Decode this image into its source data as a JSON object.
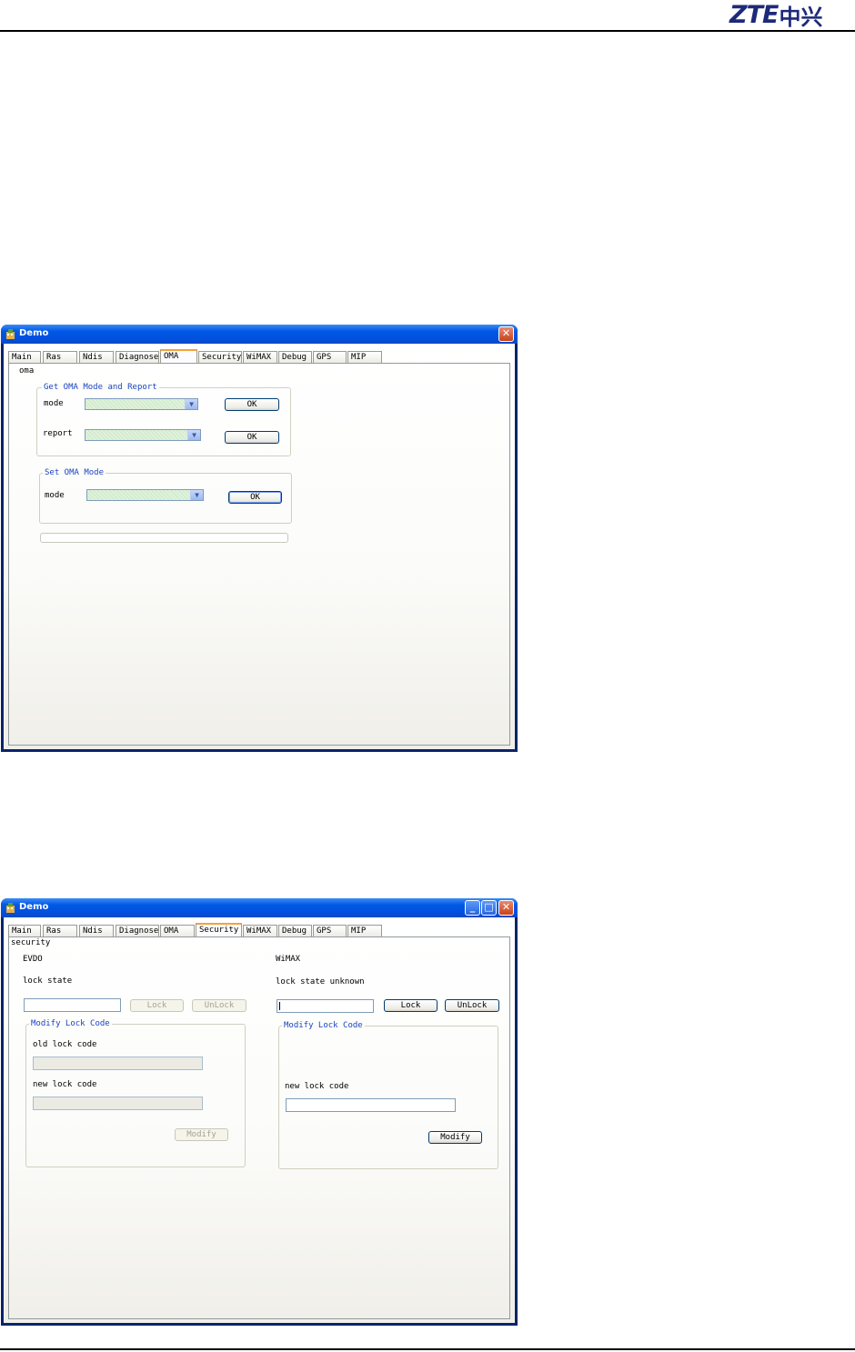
{
  "header": {
    "logo_latin": "ZTE",
    "logo_cn": "中兴"
  },
  "window1": {
    "title": "Demo",
    "tabs": [
      "Main",
      "Ras",
      "Ndis",
      "Diagnose",
      "OMA",
      "Security",
      "WiMAX",
      "Debug",
      "GPS",
      "MIP"
    ],
    "active_tab": "OMA",
    "pane_label": "oma",
    "get_group": {
      "title": "Get OMA Mode and Report",
      "mode_label": "mode",
      "report_label": "report",
      "ok1": "OK",
      "ok2": "OK"
    },
    "set_group": {
      "title": "Set OMA Mode",
      "mode_label": "mode",
      "ok": "OK"
    }
  },
  "window2": {
    "title": "Demo",
    "tabs": [
      "Main",
      "Ras",
      "Ndis",
      "Diagnose",
      "OMA",
      "Security",
      "WiMAX",
      "Debug",
      "GPS",
      "MIP"
    ],
    "active_tab": "Security",
    "pane_label": "security",
    "evdo": {
      "heading": "EVDO",
      "lock_state": "lock state",
      "lock_button": "Lock",
      "unlock_button": "UnLock",
      "modify_group": {
        "title": "Modify Lock Code",
        "old_label": "old lock code",
        "new_label": "new lock code",
        "modify_button": "Modify"
      }
    },
    "wimax": {
      "heading": "WiMAX",
      "lock_state": "lock state unknown",
      "lock_button": "Lock",
      "unlock_button": "UnLock",
      "modify_group": {
        "title": "Modify Lock Code",
        "new_label": "new lock code",
        "modify_button": "Modify"
      }
    }
  },
  "colors": {
    "xp_title_blue": "#0058e6",
    "groupbox_legend": "#1d44c2",
    "tab_highlight": "#f2a23c",
    "close_red": "#c6431c"
  }
}
